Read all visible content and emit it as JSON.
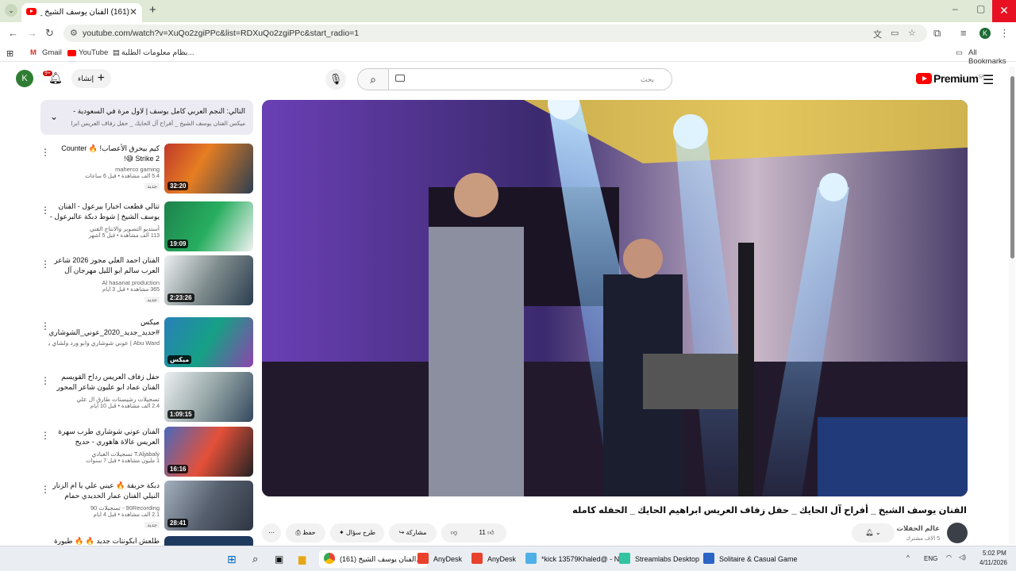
{
  "browser": {
    "tab_title": "(161) الفنان يوسف الشيخ _ أفراح",
    "url": "youtube.com/watch?v=XuQo2zgiPPc&list=RDXuQo2zgiPPc&start_radio=1",
    "profile_initial": "K",
    "bookmarks": [
      "Gmail",
      "YouTube",
      "بظام معلومات الطلبة..."
    ],
    "all_bookmarks": "All Bookmarks"
  },
  "youtube": {
    "account_initial": "K",
    "notif_count": "9+",
    "create_label": "إنشاء",
    "search_placeholder": "بحث",
    "logo_text": "Premium",
    "logo_region": "SA"
  },
  "playlist": {
    "next_label": "التالي: النجم العربي كامل يوسف | لاول مرة في السعودية - برفقة الفرقة ا...",
    "subtitle": "ميكس الفنان يوسف الشيخ _ أفراح آل الحايك _ حفل زفاف العريس ابراهيم الحايك _ ال..."
  },
  "recommendations": [
    {
      "title": "كيم بيحرق الأعصاب! 🔥 Counter Strike 2 😅!",
      "channel": "maherco gaming",
      "stats": "5.4 ألف مشاهدة • قبل 6 ساعات",
      "badge": "جديد",
      "duration": "32:20"
    },
    {
      "title": "تتالي قطعت اخبارا بيرعول - الفنان يوسف الشيخ | شوط دبكة عالبرعول - مرزم مرزم |...",
      "channel": "أستديو التصوير والانتاج الفني",
      "stats": "113 ألف مشاهدة • قبل 5 أشهر",
      "badge": "",
      "duration": "19:09"
    },
    {
      "title": "الفنان احمد العلي مجوز 2026 شاعر العرب سالم ابو الليل مهرجان آل الشلبي",
      "channel": "Al hasanat production",
      "stats": "365 مشاهدة • قبل 3 أيام",
      "badge": "جديد",
      "duration": "2:23:26"
    },
    {
      "title": "ميكس #جديد_جديد_2020_عوني_الشوشاري_اب...",
      "channel": "Abu Ward | عوني شوشاري وابو ورد ولشاي يوب و...",
      "stats": "",
      "badge": "",
      "duration": "ميكس"
    },
    {
      "title": "حفل زفاف العريس رداح القويسم الفنان عماد ابو عليون شاعر المحور بكر نابلسي مركز...",
      "channel": "تسجيلات رشيستات طارق ال علي",
      "stats": "2.4 ألف مشاهدة • قبل 10 أيام",
      "badge": "",
      "duration": "1:09:15"
    },
    {
      "title": "الفنان عوني شوشاري طرب سهرة العريس عالاة هاهوري - حديح 2018HD تصميمات",
      "channel": "T.Aljabaly تسجيلات العبادي",
      "stats": "1 مليون مشاهدة • قبل 7 سنوات",
      "badge": "",
      "duration": "16:16"
    },
    {
      "title": "دبكة حريقة 🔥 عيني علي يا ام الزنار النيلي الفنان عمار الحديدي حمام زيزت شدادة نتي...",
      "channel": "90Recording - تسجيلات 90",
      "stats": "2.1 ألف مشاهدة • قبل 4 أيام",
      "badge": "جديد",
      "duration": "28:41"
    },
    {
      "title": "طلعش ابكونتات جديد 🔥 🔥 طيورة",
      "channel": "",
      "stats": "",
      "badge": "",
      "duration": ""
    }
  ],
  "video": {
    "title": "الفنان يوسف الشيخ _ أفراح آل الحايك _ حفل زفاف العريس ابراهيم الحايك _ الحفله كامله",
    "channel": "عالم الحفلات",
    "subscribers": "5 الاف مشترك",
    "likes": "11",
    "share": "مشاركة",
    "ask": "طرح سؤال",
    "save": "حفظ"
  },
  "taskbar": {
    "items": [
      "(161) الفنان يوسف الشيخ...",
      "AnyDesk",
      "AnyDesk",
      "*kick 13579Khaled@ - N",
      "Streamlabs Desktop",
      "Solitaire & Casual Game"
    ],
    "lang": "ENG",
    "time": "5:02 PM",
    "date": "4/11/2026"
  }
}
